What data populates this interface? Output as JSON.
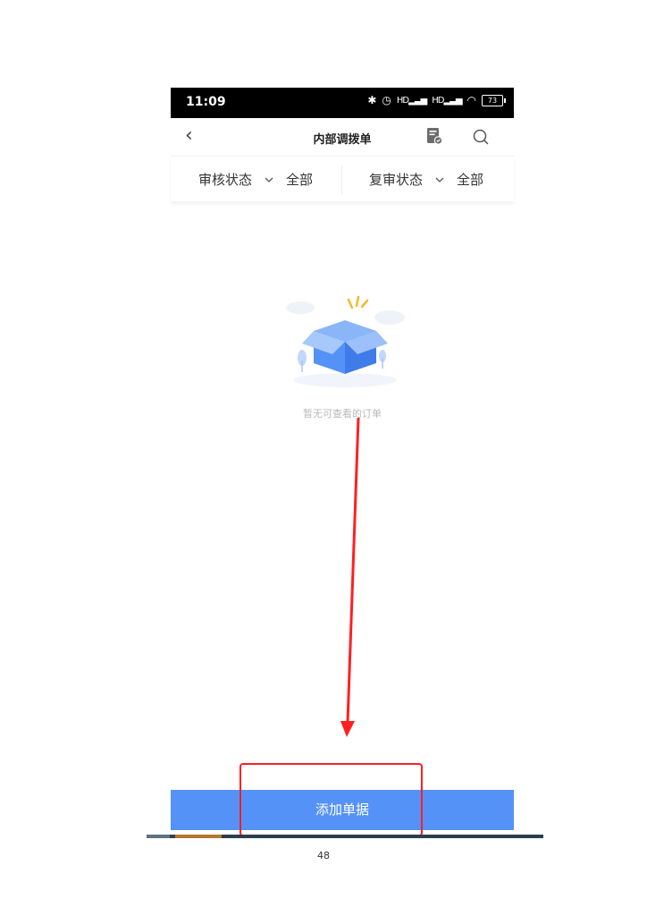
{
  "status_bar": {
    "time": "11:09",
    "signal_1": "HD",
    "signal_2": "HD",
    "battery": "73"
  },
  "navbar": {
    "back_icon": "chevron-left",
    "title": "内部调拨单",
    "doc_icon": "document-icon",
    "search_icon": "search-icon"
  },
  "filters": {
    "audit_label": "审核状态",
    "audit_value": "全部",
    "reaudit_label": "复审状态",
    "reaudit_value": "全部"
  },
  "empty_state": {
    "message": "暂无可查看的订单"
  },
  "action": {
    "add_label": "添加单据"
  },
  "page": {
    "number": "48"
  },
  "colors": {
    "primary": "#5592f7",
    "annotation": "#ff2020"
  }
}
